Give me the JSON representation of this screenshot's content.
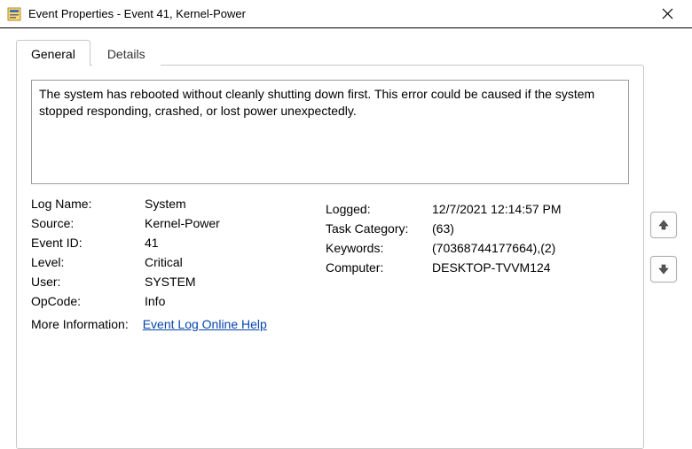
{
  "window": {
    "title": "Event Properties - Event 41, Kernel-Power"
  },
  "tabs": {
    "general": "General",
    "details": "Details"
  },
  "event": {
    "description": "The system has rebooted without cleanly shutting down first. This error could be caused if the system stopped responding, crashed, or lost power unexpectedly.",
    "labels": {
      "log_name": "Log Name:",
      "source": "Source:",
      "event_id": "Event ID:",
      "level": "Level:",
      "user": "User:",
      "opcode": "OpCode:",
      "more_info": "More Information:",
      "logged": "Logged:",
      "task_category": "Task Category:",
      "keywords": "Keywords:",
      "computer": "Computer:"
    },
    "values": {
      "log_name": "System",
      "source": "Kernel-Power",
      "event_id": "41",
      "level": "Critical",
      "user": "SYSTEM",
      "opcode": "Info",
      "more_info_link": "Event Log Online Help",
      "logged": "12/7/2021 12:14:57 PM",
      "task_category": "(63)",
      "keywords": "(70368744177664),(2)",
      "computer": "DESKTOP-TVVM124"
    }
  }
}
